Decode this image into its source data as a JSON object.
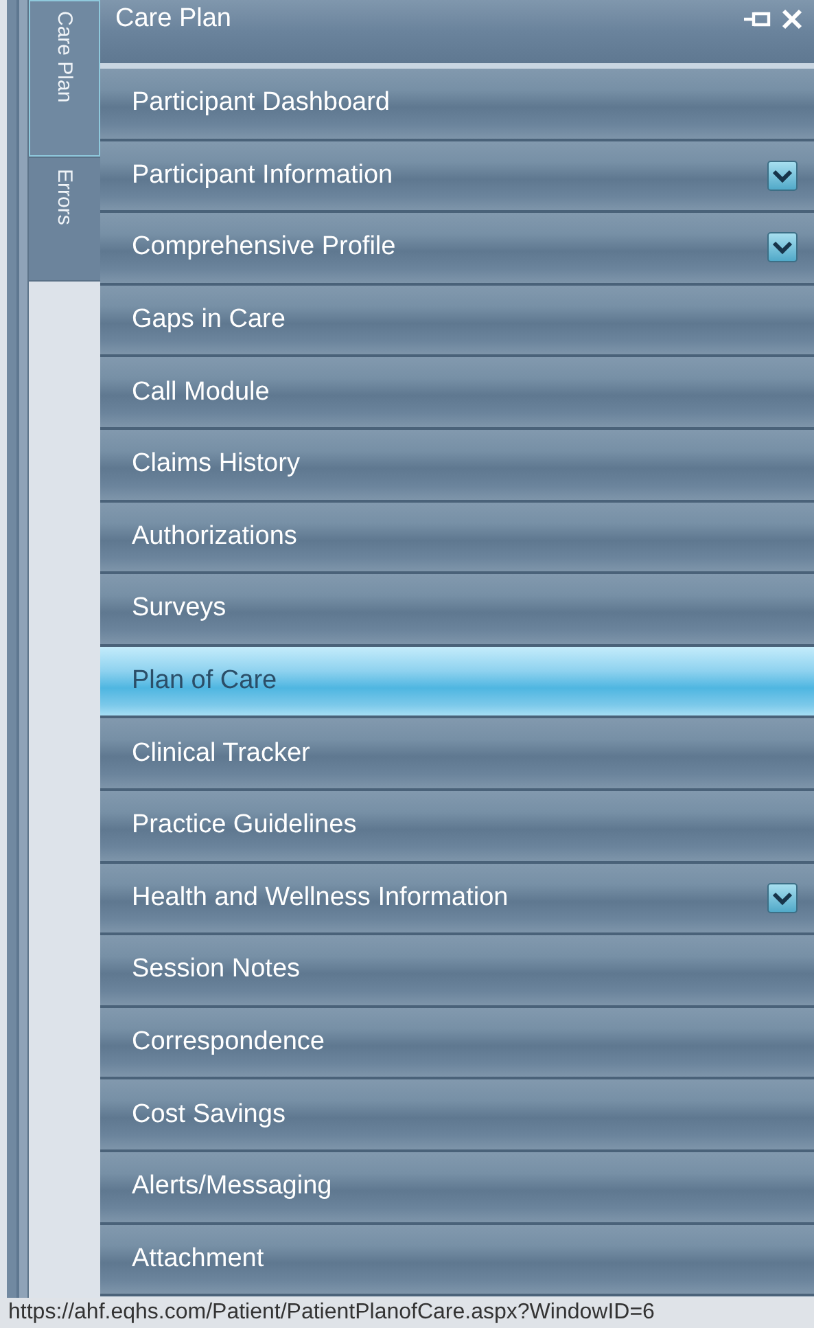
{
  "sidebar_tabs": [
    {
      "label": "Care Plan",
      "selected": true
    },
    {
      "label": "Errors",
      "selected": false
    }
  ],
  "panel": {
    "title": "Care Plan"
  },
  "menu_items": [
    {
      "label": "Participant Dashboard",
      "selected": false,
      "expandable": false
    },
    {
      "label": "Participant Information",
      "selected": false,
      "expandable": true
    },
    {
      "label": "Comprehensive Profile",
      "selected": false,
      "expandable": true
    },
    {
      "label": "Gaps in Care",
      "selected": false,
      "expandable": false
    },
    {
      "label": "Call Module",
      "selected": false,
      "expandable": false
    },
    {
      "label": "Claims History",
      "selected": false,
      "expandable": false
    },
    {
      "label": "Authorizations",
      "selected": false,
      "expandable": false
    },
    {
      "label": "Surveys",
      "selected": false,
      "expandable": false
    },
    {
      "label": "Plan of Care",
      "selected": true,
      "expandable": false
    },
    {
      "label": "Clinical Tracker",
      "selected": false,
      "expandable": false
    },
    {
      "label": "Practice Guidelines",
      "selected": false,
      "expandable": false
    },
    {
      "label": "Health and Wellness Information",
      "selected": false,
      "expandable": true
    },
    {
      "label": "Session Notes",
      "selected": false,
      "expandable": false
    },
    {
      "label": "Correspondence",
      "selected": false,
      "expandable": false
    },
    {
      "label": "Cost Savings",
      "selected": false,
      "expandable": false
    },
    {
      "label": "Alerts/Messaging",
      "selected": false,
      "expandable": false
    },
    {
      "label": "Attachment",
      "selected": false,
      "expandable": false
    }
  ],
  "status_bar": {
    "url": "https://ahf.eqhs.com/Patient/PatientPlanofCare.aspx?WindowID=6"
  }
}
